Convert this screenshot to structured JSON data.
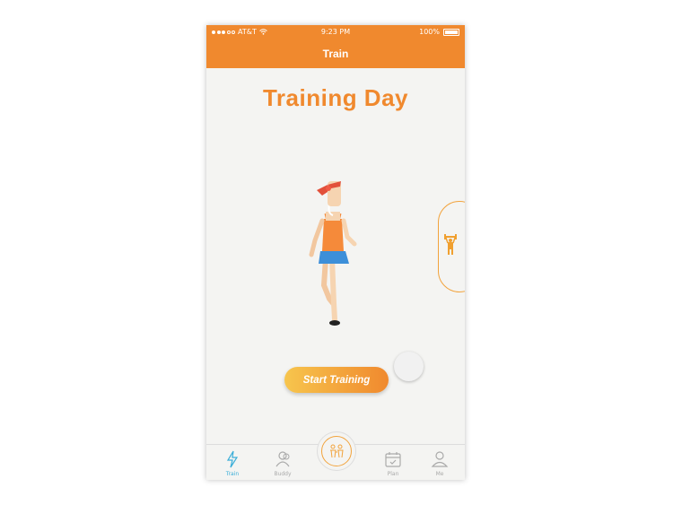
{
  "status": {
    "carrier": "AT&T",
    "time": "9:23 PM",
    "battery": "100%"
  },
  "navbar": {
    "title": "Train"
  },
  "main": {
    "heading": "Training Day",
    "start_button": "Start Training"
  },
  "tabs": [
    {
      "label": "Train",
      "icon": "lightning-icon",
      "active": true
    },
    {
      "label": "Buddy",
      "icon": "buddy-icon"
    },
    {
      "label": "",
      "icon": "group-icon"
    },
    {
      "label": "Plan",
      "icon": "calendar-icon"
    },
    {
      "label": "Me",
      "icon": "person-icon"
    }
  ],
  "colors": {
    "accent": "#f0892e",
    "button_start": "#f7c54d",
    "active_tab": "#3aaed8"
  }
}
